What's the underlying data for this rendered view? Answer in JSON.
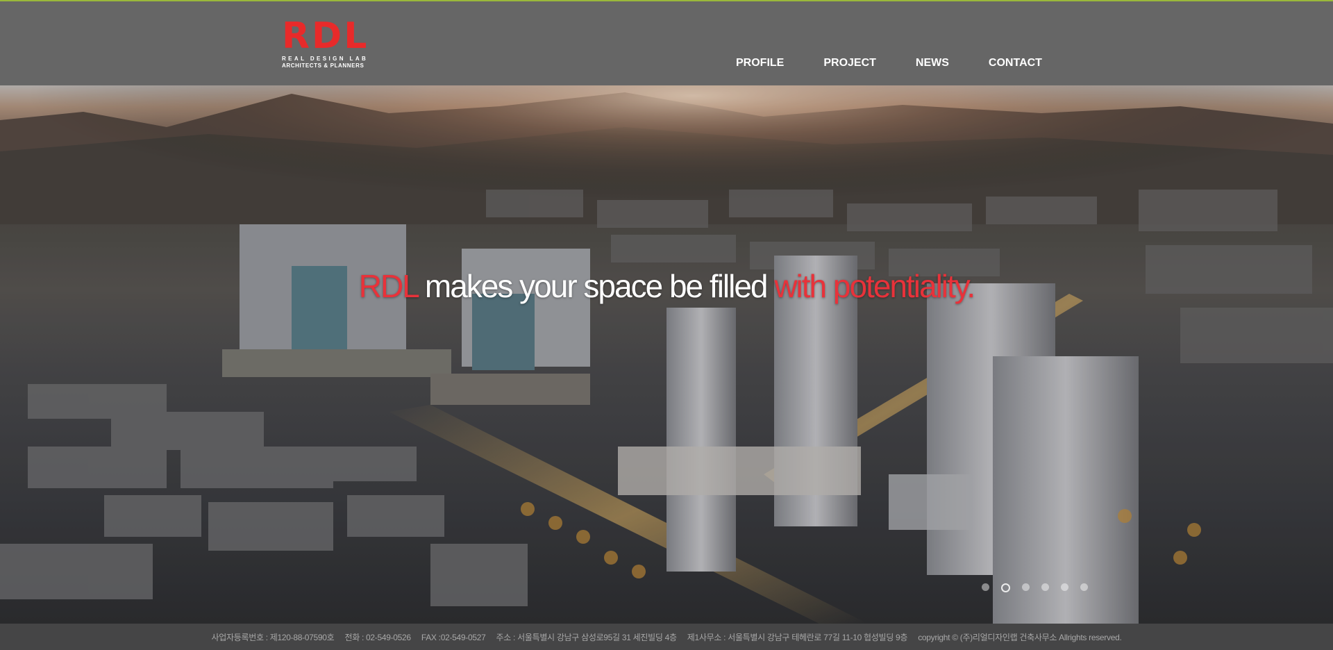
{
  "logo": {
    "mark": "RDL",
    "line1": "REAL DESIGN LAB",
    "line2": "ARCHITECTS & PLANNERS"
  },
  "nav": {
    "items": [
      {
        "label": "PROFILE"
      },
      {
        "label": "PROJECT"
      },
      {
        "label": "NEWS"
      },
      {
        "label": "CONTACT"
      }
    ]
  },
  "hero": {
    "tagline_brand": "RDL",
    "tagline_main": "makes your space be filled",
    "tagline_accent": "with potentiality.",
    "slide_count": 6,
    "active_slide": 1
  },
  "footer": {
    "reg": "사업자등록번호 : 제120-88-07590호",
    "phone": "전화 : 02-549-0526",
    "fax": "FAX :02-549-0527",
    "address": "주소 : 서울특별시 강남구 삼성로95길 31 세진빌딩 4층",
    "office2": "제1사무소 : 서울특별시 강남구 테헤란로 77길 11-10 협성빌딩 9층",
    "copyright": "copyright © (주)리얼디자인랩 건축사무소 Allrights reserved."
  },
  "colors": {
    "brand_red": "#e82a2a",
    "header_bg": "#666666",
    "accent_line": "#9ab83a"
  }
}
